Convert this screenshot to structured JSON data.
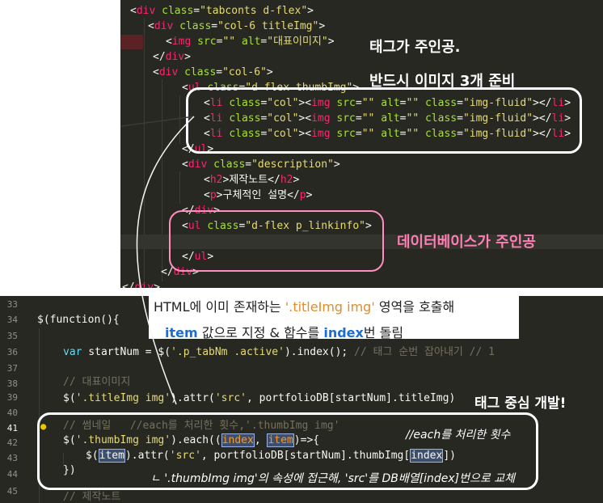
{
  "top_code": {
    "lines": [
      [
        "<div class=\"tabconts d-flex\">"
      ],
      [
        "<div class=\"col-6 titleImg\">"
      ],
      [
        "<img src=\"\" alt=\"대표이미지\">"
      ],
      [
        "</div>"
      ],
      [
        "<div class=\"col-6\">"
      ],
      [
        "<ul class=\"d-flex thumbImg\">"
      ],
      [
        "<li class=\"col\"><img src=\"\" alt=\"\" class=\"img-fluid\"></li>"
      ],
      [
        "<li class=\"col\"><img src=\"\" alt=\"\" class=\"img-fluid\"></li>"
      ],
      [
        "<li class=\"col\"><img src=\"\" alt=\"\" class=\"img-fluid\"></li>"
      ],
      [
        "</ul>"
      ],
      [
        "<div class=\"description\">"
      ],
      [
        "<h2>제작노트</h2>"
      ],
      [
        "<p>구체적인 설명</p>"
      ],
      [
        "</div>"
      ],
      [
        "<ul class=\"d-flex p_linkinfo\">"
      ],
      [
        ""
      ],
      [
        "</ul>"
      ],
      [
        "</div>"
      ],
      [
        "</div>"
      ]
    ]
  },
  "annotations": {
    "tag_main": "태그가 주인공.",
    "three_images": "반드시 이미지 3개 준비",
    "database_main": "데이터베이스가 주인공",
    "tag_dev": "태그 중심 개발!",
    "each_count": "//each를 처리한 횟수",
    "replace_note": "ㄴ '.thumbImg img'의 속성에 접근해, 'src'를 DB배열[index]번으로 교체"
  },
  "caption": {
    "line1_a": "HTML에 이미 존재하는 ",
    "line1_b": "'.titleImg img'",
    "line1_c": " 영역을 호출해",
    "line2_a": "item",
    "line2_b": " 값으로 지정 & 함수를 ",
    "line2_c": "index",
    "line2_d": "번 돌림"
  },
  "bottom_code": {
    "line_numbers": [
      "33",
      "34",
      "35",
      "36",
      "37",
      "38",
      "39",
      "40",
      "41",
      "42",
      "43",
      "44",
      "45"
    ],
    "l34": "$(function(){",
    "l36_a": "var",
    "l36_b": " startNum = ",
    "l36_c": "$(",
    "l36_d": "'.p_tabNm .active'",
    "l36_e": ").index(); ",
    "l36_f": "// 태그 순번 잡아내기 // 1",
    "l38": "// 대표이미지",
    "l39_a": "$(",
    "l39_b": "'.titleImg img'",
    "l39_c": ").attr(",
    "l39_d": "'src'",
    "l39_e": ", portfolioDB[startNum].titleImg)",
    "l41_a": "// 썸네일   //each를 처리한 횟수,",
    "l41_b": "'.thumbImg img'",
    "l42_a": "$(",
    "l42_b": "'.thumbImg img'",
    "l42_c": ").each((",
    "l42_d": "index",
    "l42_e": ", ",
    "l42_f": "item",
    "l42_g": ")=>{",
    "l43_a": "$(",
    "l43_b": "item",
    "l43_c": ").attr(",
    "l43_d": "'src'",
    "l43_e": ", portfolioDB[startNum].thumbImg[",
    "l43_f": "index",
    "l43_g": "])",
    "l44": "})",
    "l45": "// 제작노트"
  },
  "colors": {
    "editor_bg": "#272822",
    "tag": "#f92672",
    "attr": "#a6e22e",
    "string": "#e6db74",
    "pink_annotation": "#ff7fb5"
  }
}
